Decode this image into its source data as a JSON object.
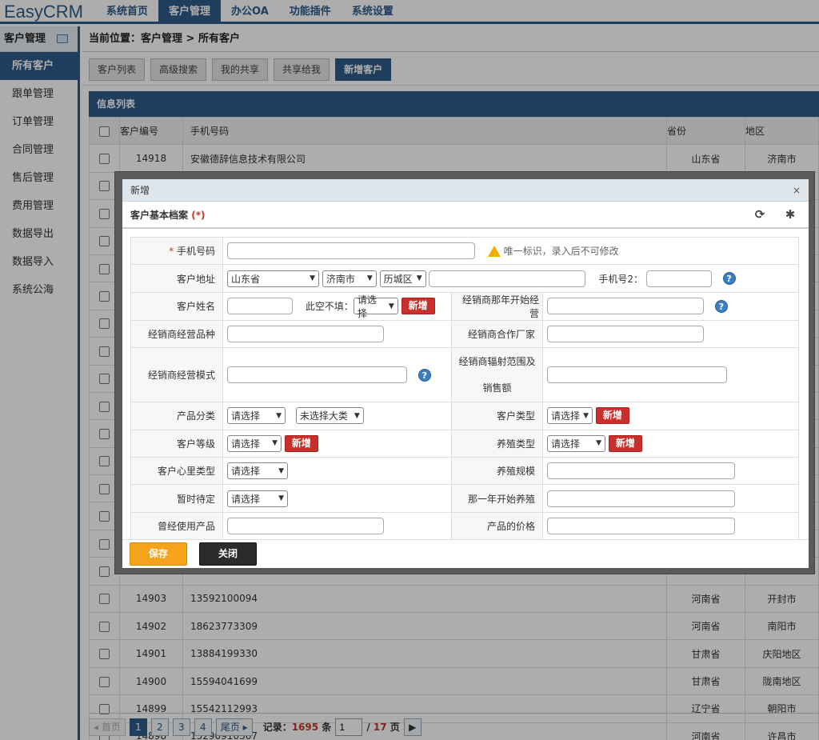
{
  "app": {
    "logo": "EasyCRM"
  },
  "topnav": [
    "系统首页",
    "客户管理",
    "办公OA",
    "功能插件",
    "系统设置"
  ],
  "sidebar": {
    "header": "客户管理",
    "items": [
      "所有客户",
      "跟单管理",
      "订单管理",
      "合同管理",
      "售后管理",
      "费用管理",
      "数据导出",
      "数据导入",
      "系统公海"
    ]
  },
  "breadcrumb": "当前位置：客户管理 > 所有客户",
  "toolbar": [
    "客户列表",
    "高级搜索",
    "我的共享",
    "共享给我",
    "新增客户"
  ],
  "list": {
    "title": "信息列表",
    "headers": [
      "客户编号",
      "手机号码",
      "省份",
      "地区"
    ],
    "rows": [
      {
        "id": "14918",
        "phone": "安徽德辞信息技术有限公司",
        "province": "山东省",
        "region": "济南市"
      },
      {
        "id": "",
        "phone": "",
        "province": "",
        "region": ""
      },
      {
        "id": "",
        "phone": "",
        "province": "",
        "region": ""
      },
      {
        "id": "",
        "phone": "",
        "province": "",
        "region": ""
      },
      {
        "id": "",
        "phone": "",
        "province": "",
        "region": ""
      },
      {
        "id": "",
        "phone": "",
        "province": "",
        "region": ""
      },
      {
        "id": "",
        "phone": "",
        "province": "",
        "region": ""
      },
      {
        "id": "",
        "phone": "",
        "province": "",
        "region": ""
      },
      {
        "id": "",
        "phone": "",
        "province": "",
        "region": ""
      },
      {
        "id": "",
        "phone": "",
        "province": "",
        "region": ""
      },
      {
        "id": "",
        "phone": "",
        "province": "",
        "region": ""
      },
      {
        "id": "",
        "phone": "",
        "province": "",
        "region": ""
      },
      {
        "id": "",
        "phone": "",
        "province": "",
        "region": ""
      },
      {
        "id": "",
        "phone": "",
        "province": "",
        "region": ""
      },
      {
        "id": "",
        "phone": "",
        "province": "",
        "region": ""
      },
      {
        "id": "",
        "phone": "",
        "province": "",
        "region": ""
      },
      {
        "id": "14903",
        "phone": "13592100094",
        "province": "河南省",
        "region": "开封市"
      },
      {
        "id": "14902",
        "phone": "18623773309",
        "province": "河南省",
        "region": "南阳市"
      },
      {
        "id": "14901",
        "phone": "13884199330",
        "province": "甘肃省",
        "region": "庆阳地区"
      },
      {
        "id": "14900",
        "phone": "15594041699",
        "province": "甘肃省",
        "region": "陇南地区"
      },
      {
        "id": "14899",
        "phone": "15542112993",
        "province": "辽宁省",
        "region": "朝阳市"
      },
      {
        "id": "14898",
        "phone": "15290910367",
        "province": "河南省",
        "region": "许昌市"
      }
    ]
  },
  "pager": {
    "first": "◂ 首页",
    "pages": [
      "1",
      "2",
      "3",
      "4"
    ],
    "last": "尾页 ▸",
    "records_label": "记录：",
    "records": "1695",
    "records_unit": "条",
    "page_value": "1",
    "total_pages": "17",
    "page_unit": "页",
    "go": "▶"
  },
  "dialog": {
    "title": "新增",
    "close": "×",
    "subtitle": "客户基本档案",
    "subtitle_star": "(*)",
    "save": "保存",
    "close_btn": "关闭",
    "form": {
      "phone_label": "手机号码",
      "phone_hint": "唯一标识，录入后不可修改",
      "address_label": "客户地址",
      "province": "山东省",
      "city": "济南市",
      "district": "历城区",
      "phone2_label": "手机号2：",
      "name_label": "客户姓名",
      "nofill_label": "此空不填：",
      "nofill_select": "请选择",
      "add": "新增",
      "dealer_year_label": "经销商那年开始经营",
      "dealer_variety_label": "经销商经营品种",
      "dealer_partner_label": "经销商合作厂家",
      "dealer_mode_label": "经销商经营模式",
      "dealer_range_label_1": "经销商辐射范围及",
      "dealer_range_label_2": "销售额",
      "product_cat_label": "产品分类",
      "product_cat_select": "请选择",
      "product_cat_select2": "未选择大类",
      "customer_type_label": "客户类型",
      "customer_type_select": "请选择",
      "customer_level_label": "客户等级",
      "customer_level_select": "请选择",
      "farm_type_label": "养殖类型",
      "farm_type_select": "请选择",
      "mind_type_label": "客户心里类型",
      "mind_type_select": "请选择",
      "farm_scale_label": "养殖规模",
      "pending_label": "暂时待定",
      "pending_select": "请选择",
      "farm_year_label": "那一年开始养殖",
      "used_product_label": "曾经使用产品",
      "product_price_label": "产品的价格"
    }
  }
}
